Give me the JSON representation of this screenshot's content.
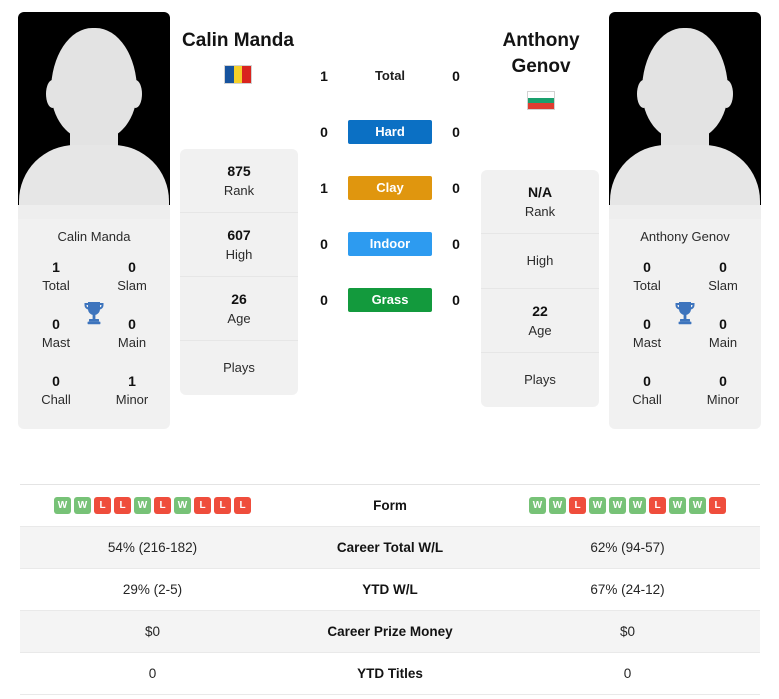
{
  "colors": {
    "hard": "#0b70c4",
    "clay": "#e0960e",
    "indoor": "#2d9bf0",
    "grass": "#139a3d",
    "win": "#77c277",
    "loss": "#ef4d3c",
    "trophy": "#3d74bd"
  },
  "players": {
    "left": {
      "name": "Calin Manda",
      "card_name": "Calin Manda",
      "flag": "romania-flag",
      "flag_type": "vertical",
      "flag_colors": [
        "#16539e",
        "#f5d02a",
        "#d9241f"
      ],
      "titles": [
        {
          "num": "1",
          "label": "Total"
        },
        {
          "num": "0",
          "label": "Slam"
        },
        {
          "num": "0",
          "label": "Mast"
        },
        {
          "num": "0",
          "label": "Main"
        },
        {
          "num": "0",
          "label": "Chall"
        },
        {
          "num": "1",
          "label": "Minor"
        }
      ],
      "info": [
        {
          "num": "875",
          "label": "Rank"
        },
        {
          "num": "607",
          "label": "High"
        },
        {
          "num": "26",
          "label": "Age"
        },
        {
          "num": "",
          "label": "Plays"
        }
      ]
    },
    "right": {
      "name_line1": "Anthony",
      "name_line2": "Genov",
      "card_name": "Anthony Genov",
      "flag": "bulgaria-flag",
      "flag_type": "horizontal",
      "flag_colors": [
        "#ffffff",
        "#1aa06d",
        "#e03c30"
      ],
      "titles": [
        {
          "num": "0",
          "label": "Total"
        },
        {
          "num": "0",
          "label": "Slam"
        },
        {
          "num": "0",
          "label": "Mast"
        },
        {
          "num": "0",
          "label": "Main"
        },
        {
          "num": "0",
          "label": "Chall"
        },
        {
          "num": "0",
          "label": "Minor"
        }
      ],
      "info": [
        {
          "num": "N/A",
          "label": "Rank"
        },
        {
          "num": "",
          "label": "High"
        },
        {
          "num": "22",
          "label": "Age"
        },
        {
          "num": "",
          "label": "Plays"
        }
      ]
    }
  },
  "h2h": [
    {
      "left": "1",
      "label": "Total",
      "right": "0",
      "style": "plain"
    },
    {
      "left": "0",
      "label": "Hard",
      "right": "0",
      "style": "badge",
      "color": "#0b70c4"
    },
    {
      "left": "1",
      "label": "Clay",
      "right": "0",
      "style": "badge",
      "color": "#e0960e"
    },
    {
      "left": "0",
      "label": "Indoor",
      "right": "0",
      "style": "badge",
      "color": "#2d9bf0"
    },
    {
      "left": "0",
      "label": "Grass",
      "right": "0",
      "style": "badge",
      "color": "#139a3d"
    }
  ],
  "stats": {
    "form": {
      "label": "Form",
      "left": [
        "W",
        "W",
        "L",
        "L",
        "W",
        "L",
        "W",
        "L",
        "L",
        "L"
      ],
      "right": [
        "W",
        "W",
        "L",
        "W",
        "W",
        "W",
        "L",
        "W",
        "W",
        "L"
      ]
    },
    "rows": [
      {
        "left": "54% (216-182)",
        "label": "Career Total W/L",
        "right": "62% (94-57)"
      },
      {
        "left": "29% (2-5)",
        "label": "YTD W/L",
        "right": "67% (24-12)"
      },
      {
        "left": "$0",
        "label": "Career Prize Money",
        "right": "$0"
      },
      {
        "left": "0",
        "label": "YTD Titles",
        "right": "0"
      }
    ]
  }
}
